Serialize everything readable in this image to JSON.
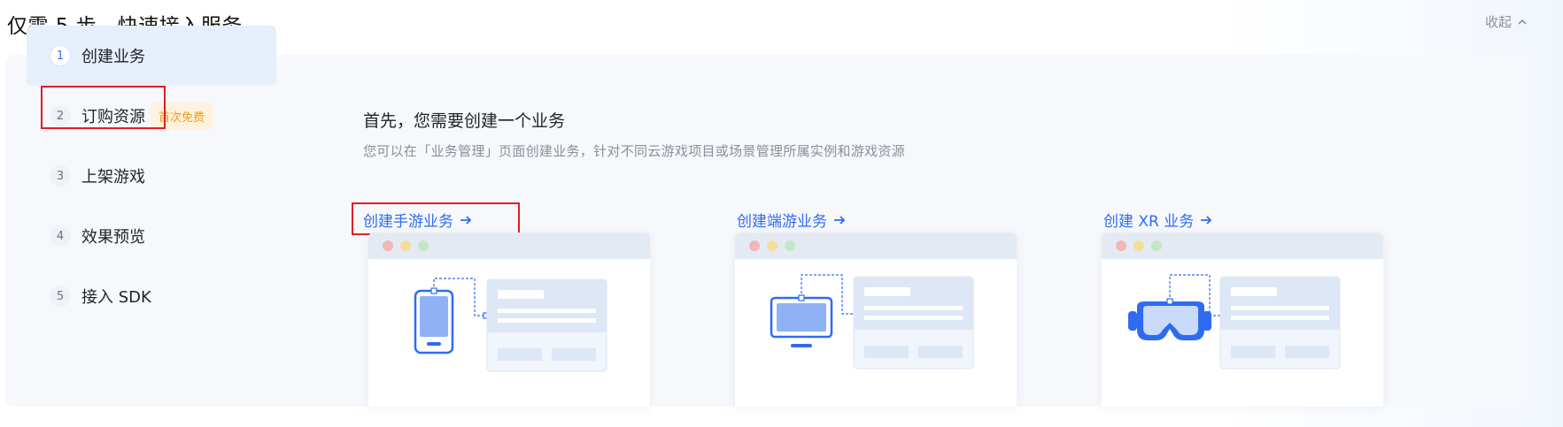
{
  "header": {
    "title": "仅需 5 步，快速接入服务",
    "collapse_label": "收起"
  },
  "steps": [
    {
      "num": "1",
      "label": "创建业务",
      "active": true
    },
    {
      "num": "2",
      "label": "订购资源",
      "tag": "首次免费"
    },
    {
      "num": "3",
      "label": "上架游戏"
    },
    {
      "num": "4",
      "label": "效果预览"
    },
    {
      "num": "5",
      "label": "接入 SDK"
    }
  ],
  "content": {
    "title": "首先，您需要创建一个业务",
    "description": "您可以在「业务管理」页面创建业务，针对不同云游戏项目或场景管理所属实例和游戏资源"
  },
  "cards": [
    {
      "link": "创建手游业务",
      "icon": "mobile-device-icon"
    },
    {
      "link": "创建端游业务",
      "icon": "desktop-monitor-icon"
    },
    {
      "link": "创建 XR 业务",
      "icon": "vr-headset-icon"
    }
  ],
  "colors": {
    "accent": "#2f6bf2",
    "highlight": "#e11d2a",
    "tag_text": "#ee9b1a",
    "tag_bg": "#fff2dc"
  }
}
